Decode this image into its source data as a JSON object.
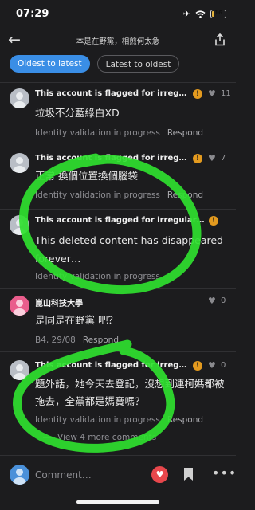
{
  "status_bar": {
    "time": "07:29",
    "battery": "16"
  },
  "header": {
    "title": "本是在野黨，相煎何太急"
  },
  "sort_tabs": [
    {
      "label": "Oldest to latest",
      "active": true
    },
    {
      "label": "Latest to oldest",
      "active": false
    }
  ],
  "comments": [
    {
      "author": "This account is flagged for irregularities",
      "likes": "11",
      "text": "垃圾不分藍綠白XD",
      "meta": "Identity validation in progress",
      "respond": "Respond"
    },
    {
      "author": "This account is flagged for irregularities",
      "likes": "7",
      "text": "正常 換個位置換個腦袋",
      "meta": "Identity validation in progress",
      "respond": "Respond"
    },
    {
      "author": "This account is flagged for irregularities",
      "likes": "",
      "text": "This deleted content has disappeared forever…",
      "meta": "Identity validation in progress",
      "respond": ""
    },
    {
      "author": "崑山科技大學",
      "likes": "0",
      "text": "是同是在野黨 吧？",
      "meta": "B4, 29/08",
      "respond": "Respond"
    },
    {
      "author": "This account is flagged for irregularities",
      "likes": "0",
      "text": "題外話，她今天去登記，沒想到連柯媽都被拖去，全黨都是媽寶嗎？",
      "meta": "Identity validation in progress",
      "respond": "Respond"
    }
  ],
  "view_more": "View 4 more comments",
  "composer": {
    "placeholder": "Comment…"
  },
  "colors": {
    "accent": "#3a8ee6",
    "flag": "#e39a1f",
    "annotation": "#2fe02f",
    "like_button": "#e8474c"
  }
}
